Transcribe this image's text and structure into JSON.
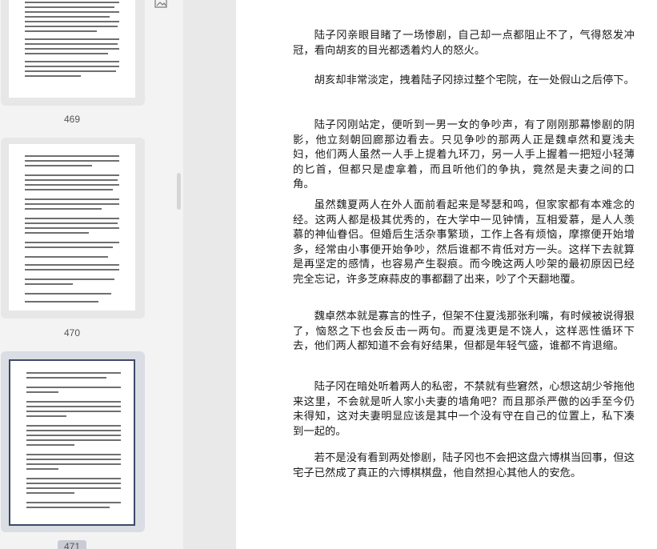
{
  "sidebar": {
    "thumbnails": [
      {
        "page_number": "469",
        "selected": false
      },
      {
        "page_number": "470",
        "selected": false
      },
      {
        "page_number": "471",
        "selected": true
      }
    ]
  },
  "document": {
    "paragraphs": [
      "陆子冈亲眼目睹了一场惨剧，自己却一点都阻止不了，气得怒发冲冠，看向胡亥的目光都透着灼人的怒火。",
      "胡亥却非常淡定，拽着陆子冈掠过整个宅院，在一处假山之后停下。",
      "陆子冈刚站定，便听到一男一女的争吵声，有了刚刚那幕惨剧的阴影，他立刻朝回廊那边看去。只见争吵的那两人正是魏卓然和夏浅夫妇，他们两人虽然一人手上提着九环刀，另一人手上握着一把短小轻薄的匕首，但都只是虚拿着，而且听他们的争执，竟然是夫妻之间的口角。",
      "虽然魏夏两人在外人面前看起来是琴瑟和鸣，但家家都有本难念的经。这两人都是极其优秀的，在大学中一见钟情，互相爱慕，是人人羡慕的神仙眷侣。但婚后生活杂事繁琐，工作上各有烦恼，摩擦便开始增多，经常由小事便开始争吵，然后谁都不肯低对方一头。这样下去就算是再坚定的感情，也容易产生裂痕。而今晚这两人吵架的最初原因已经完全忘记，许多芝麻蒜皮的事都翻了出来，吵了个天翻地覆。",
      "魏卓然本就是寡言的性子，但架不住夏浅那张利嘴，有时候被说得狠了，恼怒之下也会反击一两句。而夏浅更是不饶人，这样恶性循环下去，他们两人都知道不会有好结果，但都是年轻气盛，谁都不肯退缩。",
      "陆子冈在暗处听着两人的私密，不禁就有些窘然，心想这胡少爷拖他来这里，不会就是听人家小夫妻的墙角吧？而且那杀严傲的凶手至今仍未得知，这对夫妻明显应该是其中一个没有守在自己的位置上，私下凑到一起的。",
      "若不是没有看到两处惨剧，陆子冈也不会把这盘六博棋当回事，但这宅子已然成了真正的六博棋棋盘，他自然担心其他人的安危。"
    ]
  }
}
